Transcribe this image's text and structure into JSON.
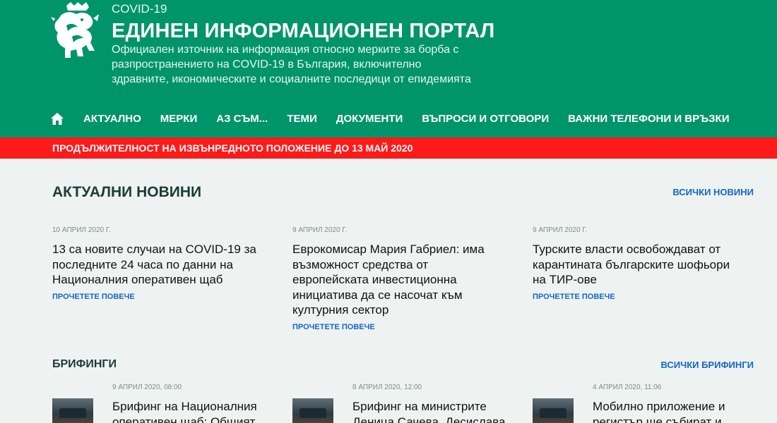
{
  "header": {
    "brand_small": "COVID-19",
    "brand_title": "ЕДИНЕН ИНФОРМАЦИОНЕН ПОРТАЛ",
    "brand_desc": "Официален източник на информация относно мерките за борба с разпространението на COVID-19 в България, включително здравните, икономическите и социалните последици от епидемията",
    "logo_icon": "lion-coat-of-arms-icon"
  },
  "nav": {
    "home_icon": "home-icon",
    "items": [
      {
        "label": "АКТУАЛНО"
      },
      {
        "label": "МЕРКИ"
      },
      {
        "label": "АЗ СЪМ..."
      },
      {
        "label": "ТЕМИ"
      },
      {
        "label": "ДОКУМЕНТИ"
      },
      {
        "label": "ВЪПРОСИ И ОТГОВОРИ"
      },
      {
        "label": "ВАЖНИ ТЕЛЕФОНИ И ВРЪЗКИ"
      }
    ]
  },
  "alert": {
    "text": "ПРОДЪЛЖИТЕЛНОСТ НА ИЗВЪНРЕДНОТО ПОЛОЖЕНИЕ ДО 13 МАЙ 2020"
  },
  "news": {
    "title": "АКТУАЛНИ НОВИНИ",
    "see_all": "ВСИЧКИ НОВИНИ",
    "items": [
      {
        "date": "10 АПРИЛ 2020 Г.",
        "headline": "13 са новите случаи на COVID-19 за последните 24 часа по данни на Националния оперативен щаб",
        "more": "ПРОЧЕТЕТЕ ПОВЕЧЕ"
      },
      {
        "date": "9 АПРИЛ 2020 Г.",
        "headline": "Еврокомисар Мария Габриел: има възможност средства от европейската инвестиционна инициатива да се насочат към културния сектор",
        "more": "ПРОЧЕТЕТЕ ПОВЕЧЕ"
      },
      {
        "date": "9 АПРИЛ 2020 Г.",
        "headline": "Турските власти освобождават от карантината българските шофьори на ТИР-ове",
        "more": "ПРОЧЕТЕТЕ ПОВЕЧЕ"
      }
    ]
  },
  "briefings": {
    "title": "БРИФИНГИ",
    "see_all": "ВСИЧКИ БРИФИНГИ",
    "items": [
      {
        "date": "9 АПРИЛ 2020, 08:00",
        "headline": "Брифинг на Националния оперативен щаб: Общият"
      },
      {
        "date": "8 АПРИЛ 2020, 12:00",
        "headline": "Брифинг на министрите Деница Сачева, Десислава"
      },
      {
        "date": "4 АПРИЛ 2020, 11:06",
        "headline": "Мобилно приложение и регистър ще събират и"
      }
    ]
  },
  "colors": {
    "header_green": "#00946b",
    "alert_red": "#ff1a1a",
    "link_blue": "#1466c8",
    "page_bg": "#eef3f2"
  }
}
